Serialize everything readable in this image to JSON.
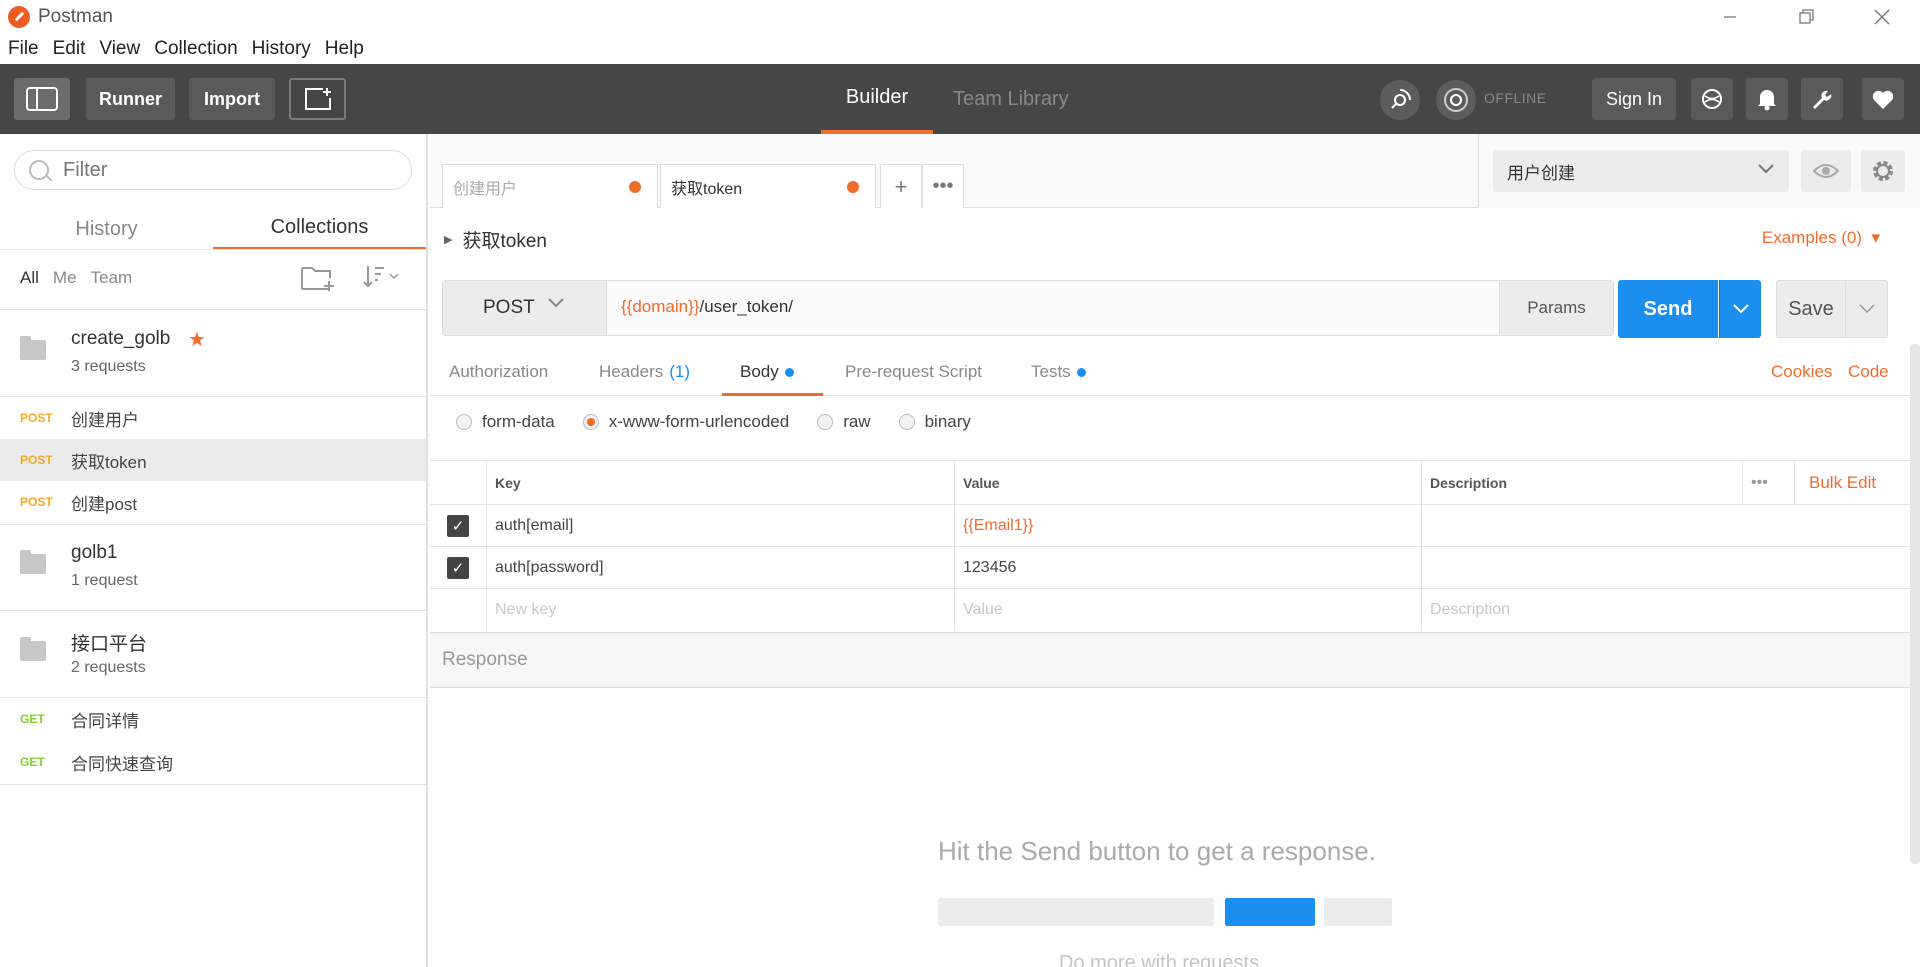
{
  "window": {
    "title": "Postman",
    "controls": [
      "minimize",
      "restore",
      "close"
    ]
  },
  "menu": [
    "File",
    "Edit",
    "View",
    "Collection",
    "History",
    "Help"
  ],
  "toolbar": {
    "runner": "Runner",
    "import": "Import",
    "tabs": {
      "builder": "Builder",
      "team_library": "Team Library"
    },
    "status": "OFFLINE",
    "sign_in": "Sign In"
  },
  "sidebar": {
    "filter_placeholder": "Filter",
    "tabs": {
      "history": "History",
      "collections": "Collections"
    },
    "filters": [
      "All",
      "Me",
      "Team"
    ],
    "collections": [
      {
        "name": "create_golb",
        "count": "3 requests",
        "starred": true,
        "requests": [
          {
            "method": "POST",
            "name": "创建用户"
          },
          {
            "method": "POST",
            "name": "获取token",
            "selected": true
          },
          {
            "method": "POST",
            "name": "创建post"
          }
        ]
      },
      {
        "name": "golb1",
        "count": "1 request"
      },
      {
        "name": "接口平台",
        "count": "2 requests",
        "requests": [
          {
            "method": "GET",
            "name": "合同详情"
          },
          {
            "method": "GET",
            "name": "合同快速查询"
          }
        ]
      }
    ]
  },
  "request_tabs": [
    {
      "name": "创建用户",
      "unsaved": true
    },
    {
      "name": "获取token",
      "unsaved": true,
      "active": true
    }
  ],
  "environment": {
    "selected": "用户创建"
  },
  "request": {
    "title": "获取token",
    "examples": "Examples (0)",
    "method": "POST",
    "url_var": "{{domain}}",
    "url_path": "/user_token/",
    "params": "Params",
    "send": "Send",
    "save": "Save"
  },
  "subtabs": {
    "authorization": "Authorization",
    "headers": "Headers",
    "headers_count": "(1)",
    "body": "Body",
    "prerequest": "Pre-request Script",
    "tests": "Tests",
    "cookies": "Cookies",
    "code": "Code"
  },
  "body_modes": {
    "form_data": "form-data",
    "urlencoded": "x-www-form-urlencoded",
    "raw": "raw",
    "binary": "binary",
    "selected": "x-www-form-urlencoded"
  },
  "kv_table": {
    "headers": {
      "key": "Key",
      "value": "Value",
      "description": "Description",
      "bulk_edit": "Bulk Edit"
    },
    "rows": [
      {
        "checked": true,
        "key": "auth[email]",
        "value": "{{Email1}}",
        "description": ""
      },
      {
        "checked": true,
        "key": "auth[password]",
        "value": "123456",
        "description": ""
      }
    ],
    "placeholders": {
      "key": "New key",
      "value": "Value",
      "description": "Description"
    }
  },
  "response": {
    "label": "Response",
    "empty_message": "Hit the Send button to get a response.",
    "more_text": "Do more with requests"
  },
  "colors": {
    "accent": "#ef6c2c",
    "send": "#1a8ff0",
    "toolbar": "#464646"
  }
}
